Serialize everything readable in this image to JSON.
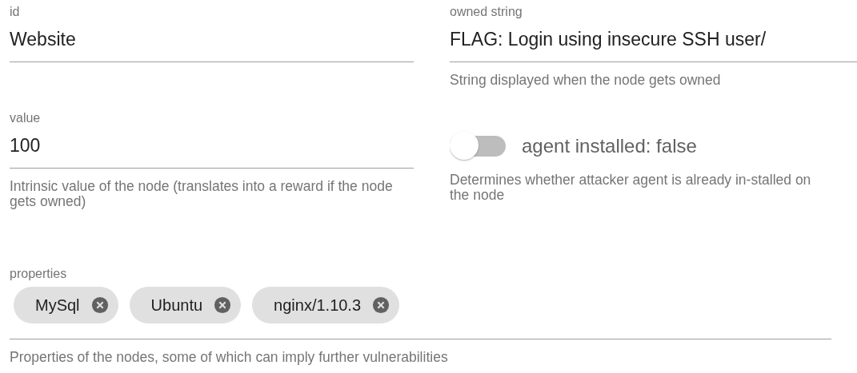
{
  "fields": [
    {
      "kind": "text",
      "label": "id",
      "value": "Website"
    },
    {
      "kind": "text",
      "label": "owned string",
      "value": "FLAG: Login using insecure SSH user/",
      "helper": "String displayed when the node gets owned"
    },
    {
      "kind": "text",
      "label": "value",
      "value": "100",
      "helper": "Intrinsic value of the node (translates into a reward if the node gets owned)"
    },
    {
      "kind": "switch",
      "label": "agent installed: false",
      "on": false,
      "helper": "Determines whether attacker agent is already in-stalled on the node"
    }
  ],
  "properties": {
    "label": "properties",
    "chips": [
      "MySql",
      "Ubuntu",
      "nginx/1.10.3"
    ],
    "helper": "Properties of the nodes, some of which can imply further vulnerabilities"
  }
}
